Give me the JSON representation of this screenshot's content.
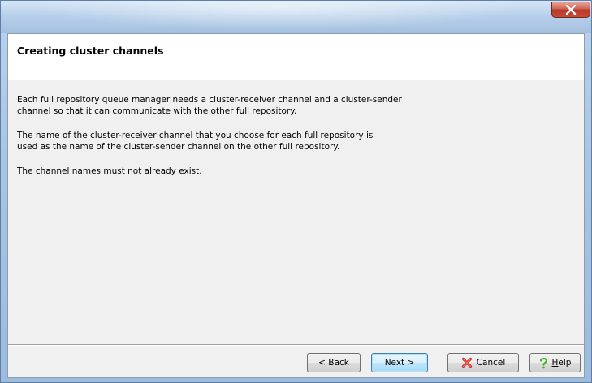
{
  "window": {
    "close_symbol": "✕"
  },
  "header": {
    "title": "Creating cluster channels"
  },
  "body": {
    "paragraph_1_line_1": "Each full repository queue manager needs a cluster-receiver channel and a cluster-sender",
    "paragraph_1_line_2": "channel so that it can communicate with the other full repository.",
    "paragraph_2_line_1": "The name of the cluster-receiver channel that you choose for each full repository is",
    "paragraph_2_line_2": "used as the name of the cluster-sender channel on the other full repository.",
    "paragraph_3_line_1": "The channel names must not already exist."
  },
  "buttons": {
    "back_label": "< Back",
    "next_label": "Next >",
    "cancel_label": "Cancel",
    "help_label_prefix": "",
    "help_label_underlined": "H",
    "help_label_rest": "elp"
  },
  "icons": {
    "close": "close-icon",
    "cancel": "red-x-icon",
    "help": "question-mark-icon"
  },
  "colors": {
    "titlebar": "#b8d0ea",
    "close_button": "#c94b35",
    "content_background": "#f0f0f0",
    "next_button_accent": "#3c7fb1",
    "cancel_icon": "#d0342c",
    "help_icon": "#4caf2a"
  }
}
